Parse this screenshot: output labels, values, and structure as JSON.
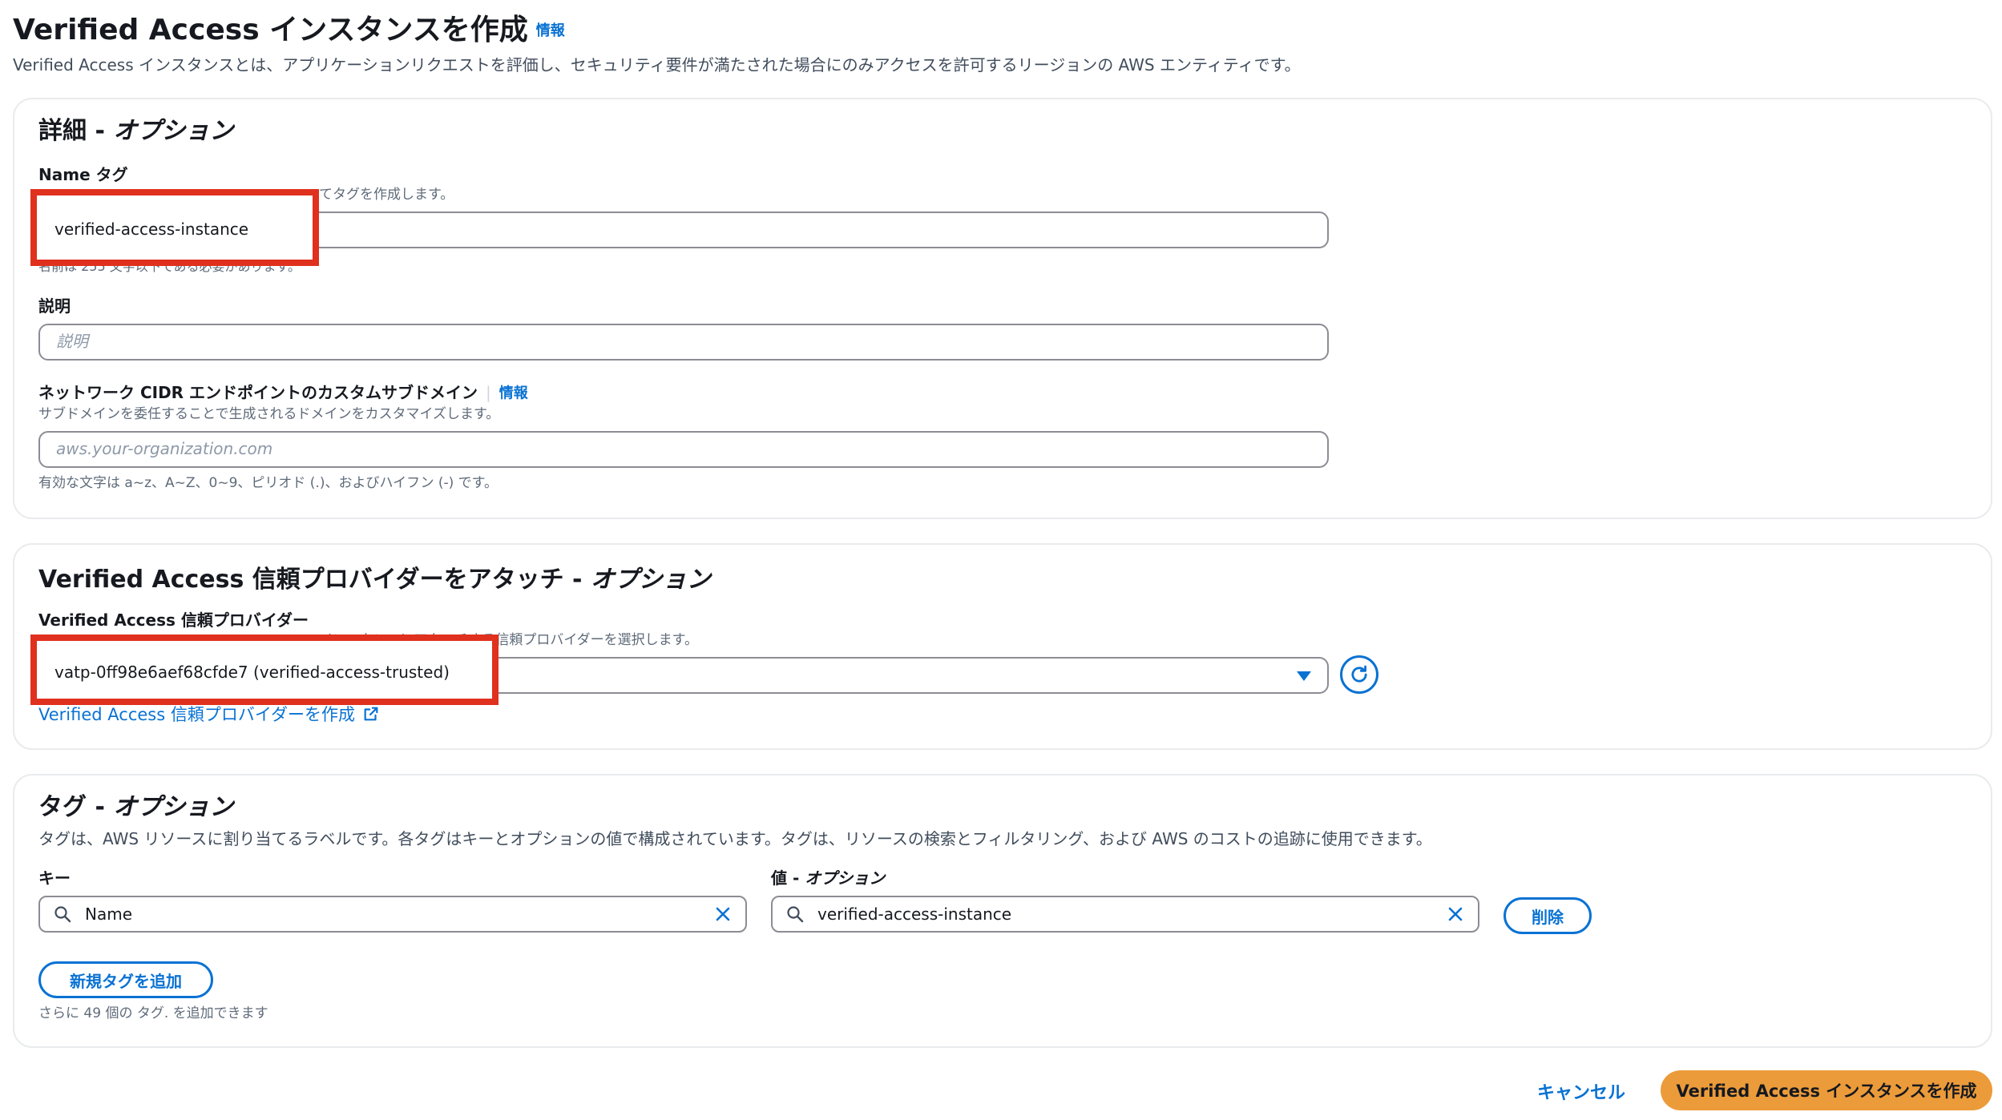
{
  "header": {
    "title": "Verified Access インスタンスを作成",
    "info": "情報",
    "subtitle": "Verified Access インスタンスとは、アプリケーションリクエストを評価し、セキュリティ要件が満たされた場合にのみアクセスを許可するリージョンの AWS エンティティです。"
  },
  "details": {
    "heading_main": "詳細 - ",
    "heading_opt": "オプション",
    "name_label": "Name タグ",
    "name_desc": "てタグを作成します。",
    "name_value": "verified-access-instance",
    "name_hint": "名前は 255 文字以下である必要があります。",
    "desc_label": "説明",
    "desc_placeholder": "説明",
    "cidr_label": "ネットワーク CIDR エンドポイントのカスタムサブドメイン",
    "cidr_info": "情報",
    "cidr_desc": "サブドメインを委任することで生成されるドメインをカスタマイズします。",
    "cidr_placeholder": "aws.your-organization.com",
    "cidr_hint": "有効な文字は a~z、A~Z、0~9、ピリオド (.)、およびハイフン (-) です。"
  },
  "trust": {
    "heading_main": "Verified Access 信頼プロバイダーをアタッチ - ",
    "heading_opt": "オプション",
    "label": "Verified Access 信頼プロバイダー",
    "desc": "インスタンスにアタッチする信頼プロバイダーを選択します。",
    "selected": "vatp-0ff98e6aef68cfde7 (verified-access-trusted)",
    "create_link": "Verified Access 信頼プロバイダーを作成"
  },
  "tags": {
    "heading_main": "タグ - ",
    "heading_opt": "オプション",
    "desc": "タグは、AWS リソースに割り当てるラベルです。各タグはキーとオプションの値で構成されています。タグは、リソースの検索とフィルタリング、および AWS のコストの追跡に使用できます。",
    "key_label": "キー",
    "value_label_main": "値 - ",
    "value_label_opt": "オプション",
    "key_value": "Name",
    "value_value": "verified-access-instance",
    "remove": "削除",
    "add": "新規タグを追加",
    "remaining": "さらに 49 個の タグ. を追加できます"
  },
  "footer": {
    "cancel": "キャンセル",
    "submit": "Verified Access インスタンスを作成"
  },
  "colors": {
    "link": "#0972d3",
    "primary": "#ec9b3a",
    "highlight": "#e0301e"
  }
}
